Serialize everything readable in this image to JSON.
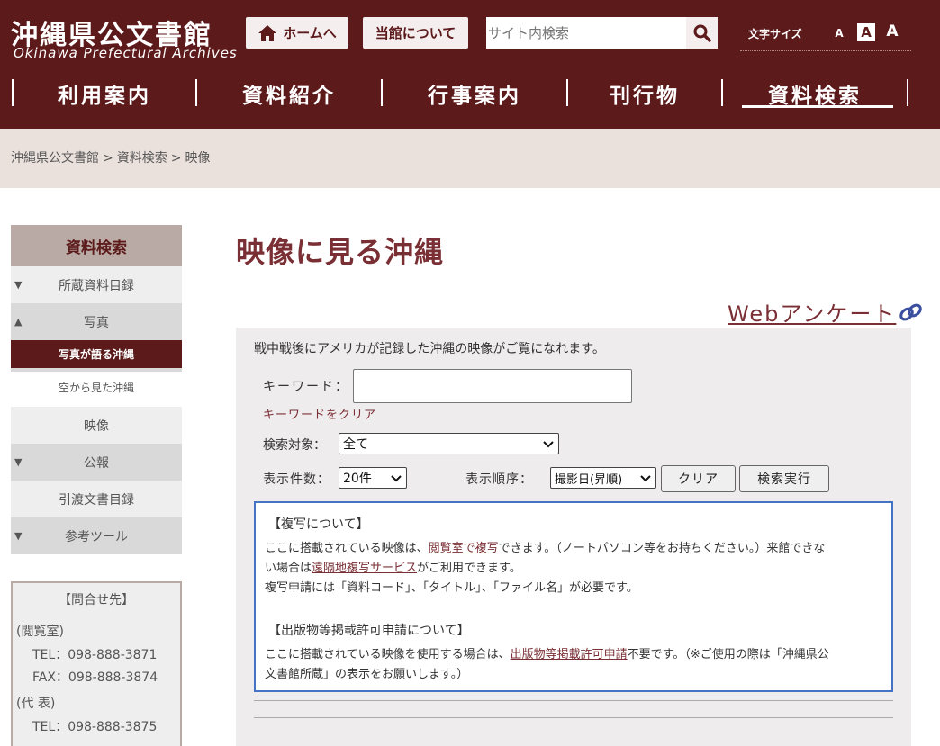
{
  "header": {
    "logo_jp": "沖縄県公文書館",
    "logo_en": "Okinawa Prefectural Archives",
    "home_label": "ホームへ",
    "about_label": "当館について",
    "search_placeholder": "サイト内検索",
    "fontsize_label": "文字サイズ",
    "fontsize_small": "A",
    "fontsize_medium": "A",
    "fontsize_large": "A",
    "colors": {
      "header_bg": "#5c1a1b",
      "button_bg": "#f4eeee",
      "accent": "#7a2f35"
    }
  },
  "nav": {
    "items": [
      {
        "label": "利用案内"
      },
      {
        "label": "資料紹介"
      },
      {
        "label": "行事案内"
      },
      {
        "label": "刊行物"
      },
      {
        "label": "資料検索",
        "active": true
      }
    ]
  },
  "breadcrumb": {
    "items": [
      "沖縄県公文書館",
      "資料検索",
      "映像"
    ],
    "separator": ">"
  },
  "sidebar": {
    "title": "資料検索",
    "items": [
      {
        "label": "所蔵資料目録",
        "arrow": "▼"
      },
      {
        "label": "写真",
        "arrow": "▲"
      },
      {
        "label": "写真が語る沖縄",
        "active": true
      },
      {
        "label": "空から見た沖縄"
      },
      {
        "label": "映像"
      },
      {
        "label": "公報",
        "arrow": "▼"
      },
      {
        "label": "引渡文書目録"
      },
      {
        "label": "参考ツール",
        "arrow": "▼"
      }
    ]
  },
  "contact": {
    "title": "【問合せ先】",
    "reading_room": "(閲覧室)",
    "reading_tel": "TEL：098-888-3871",
    "reading_fax": "FAX：098-888-3874",
    "main": "(代 表)",
    "main_tel": "TEL：098-888-3875"
  },
  "main": {
    "title": "映像に見る沖縄",
    "enquete_label": "Webアンケート",
    "intro": "戦中戦後にアメリカが記録した沖縄の映像がご覧になれます。",
    "keyword_label": "キーワード：",
    "keyword_value": "",
    "keyword_clear": "キーワードをクリア",
    "target_label": "検索対象：",
    "target_value": "全て",
    "count_label": "表示件数：",
    "count_value": "20件",
    "order_label": "表示順序：",
    "order_value": "撮影日(昇順)",
    "clear_button": "クリア",
    "search_button": "検索実行"
  },
  "notice": {
    "copy_head": "【複写について】",
    "copy_line1_a": "ここに搭載されている映像は、",
    "copy_line1_link": "閲覧室で複写",
    "copy_line1_b": "できます。（ノートパソコン等をお持ちください。）来館できな",
    "copy_line2_a": "い場合は",
    "copy_line2_link": "遠隔地複写サービス",
    "copy_line2_b": "がご利用できます。",
    "copy_line3": "複写申請には「資料コード」、「タイトル」、「ファイル名」が必要です。",
    "pub_head": "【出版物等掲載許可申請について】",
    "pub_line1_a": "ここに搭載されている映像を使用する場合は、",
    "pub_line1_link": "出版物等掲載許可申請",
    "pub_line1_b": "不要です。（※ご使用の際は「沖縄県公",
    "pub_line2": "文書館所蔵」の表示をお願いします。）"
  }
}
